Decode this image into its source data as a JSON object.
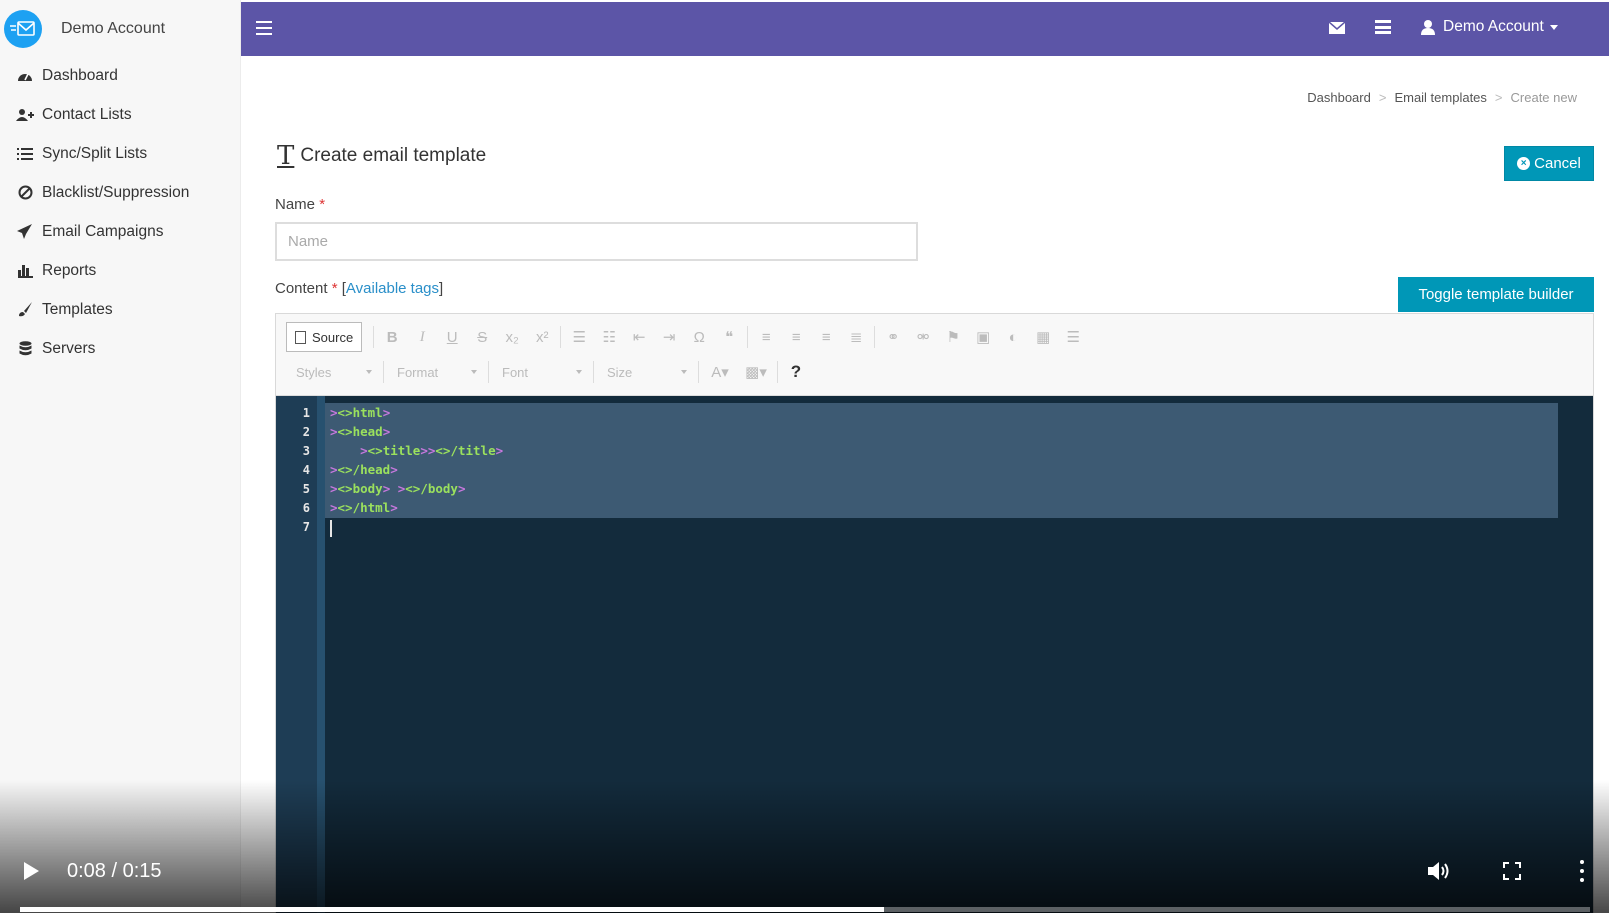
{
  "sidebar": {
    "brand": "Demo Account",
    "items": [
      {
        "label": "Dashboard",
        "icon": "dashboard-icon"
      },
      {
        "label": "Contact Lists",
        "icon": "users-add-icon"
      },
      {
        "label": "Sync/Split Lists",
        "icon": "list-icon"
      },
      {
        "label": "Blacklist/Suppression",
        "icon": "ban-icon"
      },
      {
        "label": "Email Campaigns",
        "icon": "paper-plane-icon"
      },
      {
        "label": "Reports",
        "icon": "bar-chart-icon"
      },
      {
        "label": "Templates",
        "icon": "brush-icon"
      },
      {
        "label": "Servers",
        "icon": "database-icon"
      }
    ]
  },
  "topbar": {
    "user": "Demo Account",
    "accent": "#5c55a7"
  },
  "breadcrumb": {
    "items": [
      "Dashboard",
      "Email templates",
      "Create new"
    ],
    "separator": ">"
  },
  "page": {
    "title": "Create email template",
    "cancel_label": "Cancel",
    "name_label": "Name",
    "required_mark": "*",
    "name_placeholder": "Name",
    "name_value": "",
    "content_label": "Content",
    "available_tags": "Available tags",
    "toggle_label": "Toggle template builder",
    "button_color": "#0097b7"
  },
  "editor": {
    "source_label": "Source",
    "combos": [
      "Styles",
      "Format",
      "Font",
      "Size"
    ],
    "help": "?",
    "line_numbers": [
      "1",
      "2",
      "3",
      "4",
      "5",
      "6",
      "7"
    ],
    "code_lines": [
      "<html>",
      "<head>",
      "    <title></title>",
      "</head>",
      "<body> </body>",
      "</html>",
      ""
    ]
  },
  "player": {
    "time": "0:08 / 0:15",
    "progress": 0.55
  }
}
